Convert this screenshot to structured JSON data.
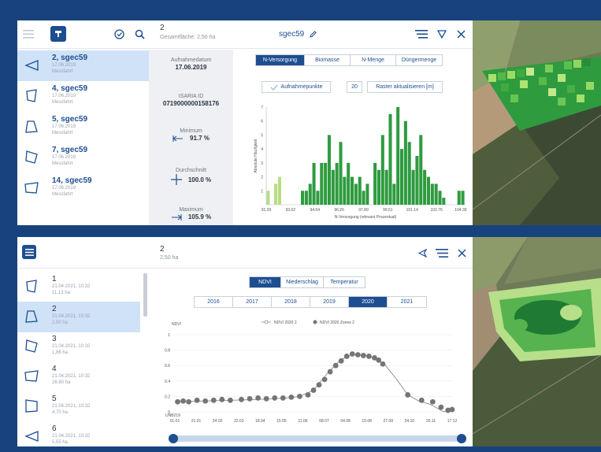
{
  "panel1": {
    "header": {
      "count": "2",
      "area": "Gesamtfläche: 2,50 ha",
      "title": "sgec59"
    },
    "fields": [
      {
        "name": "2, sgec59",
        "date": "17.06.2019",
        "type": "Messfahrt",
        "selected": true
      },
      {
        "name": "4, sgec59",
        "date": "17.06.2019",
        "type": "Messfahrt",
        "selected": false
      },
      {
        "name": "5, sgec59",
        "date": "17.06.2019",
        "type": "Messfahrt",
        "selected": false
      },
      {
        "name": "7, sgec59",
        "date": "17.06.2019",
        "type": "Messfahrt",
        "selected": false
      },
      {
        "name": "14, sgec59",
        "date": "17.06.2019",
        "type": "Messfahrt",
        "selected": false
      }
    ],
    "stats": {
      "date_label": "Aufnahmedatum",
      "date_value": "17.06.2019",
      "id_label": "ISARIA ID",
      "id_value": "0719000000158176",
      "min_label": "Minimum",
      "min_value": "91.7 %",
      "avg_label": "Durchschnitt",
      "avg_value": "100.0 %",
      "max_label": "Maximum",
      "max_value": "105.9 %"
    },
    "tabs": [
      "N-Versorgung",
      "Biomasse",
      "N-Menge",
      "Düngermenge"
    ],
    "active_tab": "N-Versorgung",
    "points_button": "Aufnahmepunkte",
    "raster_value": "20",
    "raster_button": "Raster aktualisieren [m]"
  },
  "panel2": {
    "header": {
      "count": "2",
      "area": "2,50 ha"
    },
    "fields": [
      {
        "name": "1",
        "date": "21.04.2021, 10:32",
        "area": "11,13 ha",
        "selected": false
      },
      {
        "name": "2",
        "date": "21.04.2021, 10:32",
        "area": "2,50 ha",
        "selected": true
      },
      {
        "name": "3",
        "date": "21.04.2021, 10:32",
        "area": "1,86 ha",
        "selected": false
      },
      {
        "name": "4",
        "date": "21.04.2021, 10:32",
        "area": "26,60 ha",
        "selected": false
      },
      {
        "name": "5",
        "date": "21.04.2021, 10:32",
        "area": "4,70 ha",
        "selected": false
      },
      {
        "name": "6",
        "date": "21.04.2021, 10:32",
        "area": "5,55 ha",
        "selected": false
      }
    ],
    "tabs": [
      "NDVI",
      "Niederschlag",
      "Temperatur"
    ],
    "active_tab": "NDVI",
    "years": [
      "2016",
      "2017",
      "2018",
      "2019",
      "2020",
      "2021"
    ],
    "active_year": "2020"
  },
  "chart_data": [
    {
      "type": "bar",
      "xlabel": "N-Versorgung (relevant Prozentual)",
      "ylabel": "Absolute Häufigkeit",
      "ylim": [
        0,
        7
      ],
      "yticks": [
        "1",
        "2",
        "3",
        "4",
        "5",
        "6",
        "7"
      ],
      "xtick_labels": [
        "91.39",
        "93.02",
        "94.64",
        "96.26",
        "97.89",
        "99.51",
        "101.14",
        "102.76",
        "104.39"
      ],
      "values": [
        1,
        0,
        1.5,
        2,
        0,
        0,
        0,
        0,
        0,
        1,
        1,
        1.5,
        3,
        1,
        3,
        3,
        5,
        2.5,
        3,
        4.5,
        2,
        3,
        2,
        1.5,
        2,
        1,
        1.5,
        0,
        3,
        2.5,
        5,
        2.5,
        6.5,
        1.5,
        7,
        4,
        6,
        4.5,
        2.5,
        3.5,
        5,
        2.5,
        2,
        1.5,
        1.5,
        1,
        0.5,
        0,
        0,
        0,
        1,
        1
      ],
      "highlight_count": 4
    },
    {
      "type": "line",
      "ylabel": "NDVI",
      "ylim": [
        0,
        1
      ],
      "yticks": [
        "0",
        "0.2",
        "0.4",
        "0.6",
        "0.8",
        "1"
      ],
      "xtick_labels": [
        "01.01",
        "21.01",
        "24.02",
        "22.03",
        "18.04",
        "15.05",
        "11.06",
        "08.07",
        "04.08",
        "15.08",
        "27.09",
        "24.10",
        "20.11",
        "17.12"
      ],
      "x_start_label": "UNB219",
      "legend": [
        "NDVI 2020 2",
        "NDVI 2020 Zones 2"
      ],
      "points": [
        [
          0.01,
          0.13
        ],
        [
          0.03,
          0.14
        ],
        [
          0.05,
          0.13
        ],
        [
          0.08,
          0.15
        ],
        [
          0.11,
          0.14
        ],
        [
          0.14,
          0.15
        ],
        [
          0.17,
          0.16
        ],
        [
          0.2,
          0.15
        ],
        [
          0.24,
          0.16
        ],
        [
          0.27,
          0.17
        ],
        [
          0.3,
          0.18
        ],
        [
          0.33,
          0.17
        ],
        [
          0.36,
          0.18
        ],
        [
          0.39,
          0.18
        ],
        [
          0.42,
          0.19
        ],
        [
          0.45,
          0.2
        ],
        [
          0.48,
          0.22
        ],
        [
          0.5,
          0.28
        ],
        [
          0.52,
          0.35
        ],
        [
          0.54,
          0.42
        ],
        [
          0.56,
          0.52
        ],
        [
          0.58,
          0.6
        ],
        [
          0.6,
          0.66
        ],
        [
          0.62,
          0.72
        ],
        [
          0.64,
          0.75
        ],
        [
          0.66,
          0.74
        ],
        [
          0.68,
          0.73
        ],
        [
          0.7,
          0.72
        ],
        [
          0.72,
          0.7
        ],
        [
          0.735,
          0.67
        ],
        [
          0.75,
          0.62
        ],
        [
          0.84,
          0.22
        ],
        [
          0.89,
          0.15
        ],
        [
          0.93,
          0.13
        ],
        [
          0.96,
          0.06
        ],
        [
          0.985,
          0.02
        ],
        [
          1.0,
          0.03
        ]
      ],
      "line_points": [
        [
          0.0,
          0.13
        ],
        [
          0.1,
          0.14
        ],
        [
          0.2,
          0.15
        ],
        [
          0.3,
          0.16
        ],
        [
          0.4,
          0.18
        ],
        [
          0.45,
          0.2
        ],
        [
          0.5,
          0.28
        ],
        [
          0.55,
          0.5
        ],
        [
          0.6,
          0.68
        ],
        [
          0.64,
          0.74
        ],
        [
          0.68,
          0.74
        ],
        [
          0.72,
          0.7
        ],
        [
          0.76,
          0.6
        ],
        [
          0.8,
          0.42
        ],
        [
          0.84,
          0.22
        ],
        [
          0.88,
          0.14
        ],
        [
          0.92,
          0.1
        ],
        [
          0.95,
          0.04
        ],
        [
          0.97,
          0.0
        ],
        [
          1.0,
          0.05
        ]
      ]
    }
  ],
  "colors": {
    "accent": "#1d4e91",
    "bar_dark": "#2e9b3f",
    "bar_light": "#b7dd86",
    "ndvi_point": "#757575"
  }
}
